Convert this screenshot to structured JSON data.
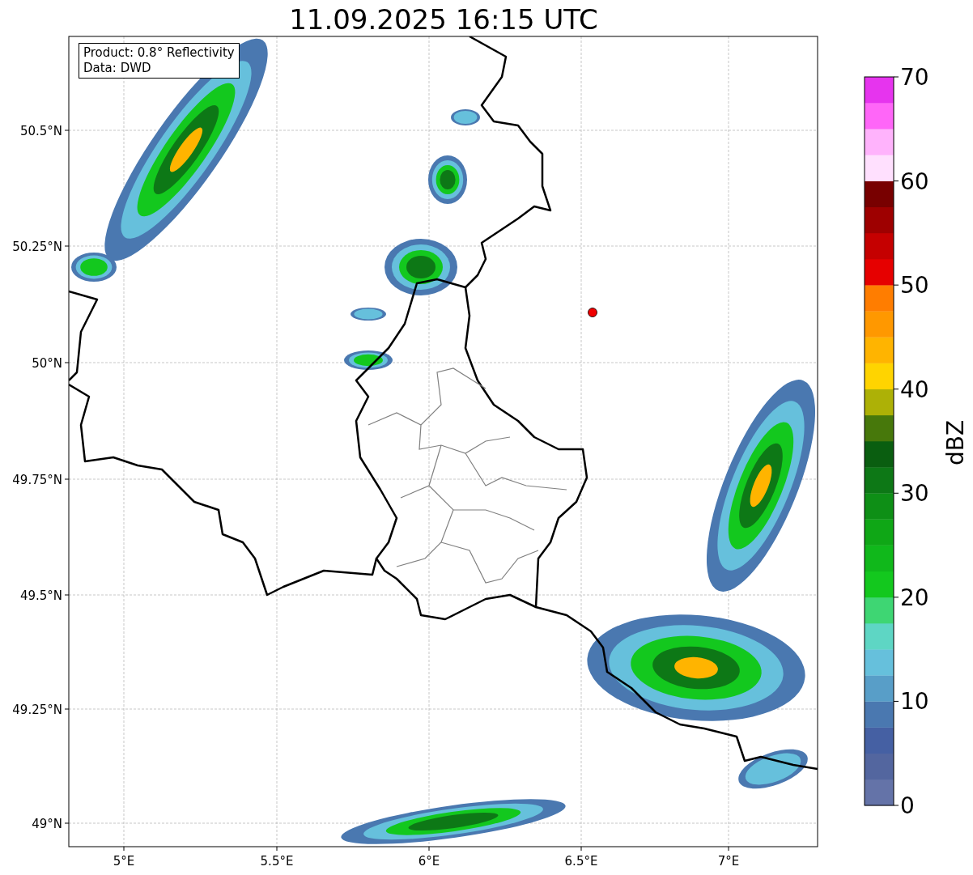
{
  "title": "11.09.2025 16:15 UTC",
  "map": {
    "annotation": [
      "Product: 0.8° Reflectivity",
      "Data: DWD"
    ],
    "xticks": [
      "5°E",
      "5.5°E",
      "6°E",
      "6.5°E",
      "7°E"
    ],
    "yticks": [
      "50.5°N",
      "50.25°N",
      "50°N",
      "49.75°N",
      "49.5°N",
      "49.25°N",
      "49°N"
    ]
  },
  "colorbar": {
    "label": "dBZ",
    "ticks": [
      "70",
      "60",
      "50",
      "40",
      "30",
      "20",
      "10",
      "0"
    ],
    "segments": [
      {
        "color": "#6473a8"
      },
      {
        "color": "#53669f"
      },
      {
        "color": "#4560a3"
      },
      {
        "color": "#4a78b0"
      },
      {
        "color": "#589ec8"
      },
      {
        "color": "#66c0dc"
      },
      {
        "color": "#5ed6c4"
      },
      {
        "color": "#3ed673"
      },
      {
        "color": "#13c81e"
      },
      {
        "color": "#10b81b"
      },
      {
        "color": "#0fa716"
      },
      {
        "color": "#0e8f16"
      },
      {
        "color": "#0d7816"
      },
      {
        "color": "#0a5e10"
      },
      {
        "color": "#47780b"
      },
      {
        "color": "#adb106"
      },
      {
        "color": "#ffd400"
      },
      {
        "color": "#ffb400"
      },
      {
        "color": "#ff9800"
      },
      {
        "color": "#ff7d00"
      },
      {
        "color": "#e60000"
      },
      {
        "color": "#c50000"
      },
      {
        "color": "#9e0000"
      },
      {
        "color": "#780000"
      },
      {
        "color": "#ffe0fe"
      },
      {
        "color": "#ffb3fc"
      },
      {
        "color": "#ff66f8"
      },
      {
        "color": "#e634ee"
      }
    ]
  }
}
